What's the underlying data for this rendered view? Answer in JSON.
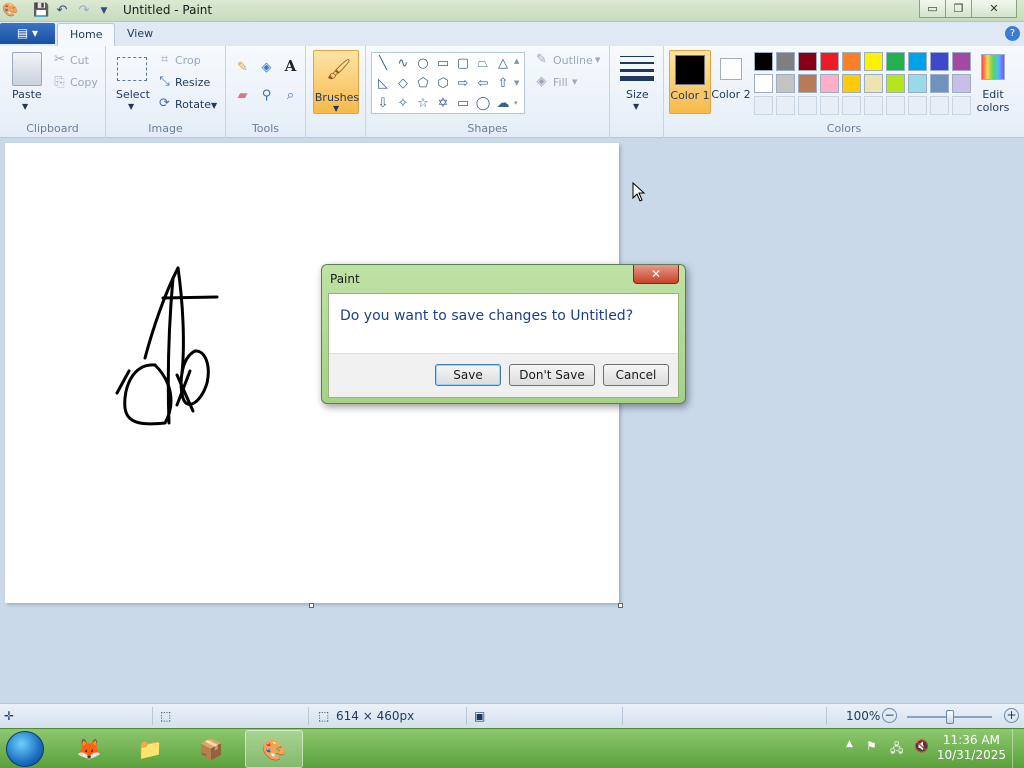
{
  "window": {
    "title": "Untitled - Paint",
    "controls": {
      "minimize": "▭",
      "maximize": "❐",
      "close": "✕"
    }
  },
  "tabs": [
    {
      "label": "Home",
      "active": true
    },
    {
      "label": "View",
      "active": false
    }
  ],
  "ribbon": {
    "clipboard": {
      "label": "Clipboard",
      "paste": "Paste",
      "cut": "Cut",
      "copy": "Copy"
    },
    "image": {
      "label": "Image",
      "select": "Select",
      "crop": "Crop",
      "resize": "Resize",
      "rotate": "Rotate"
    },
    "tools": {
      "label": "Tools"
    },
    "brushes": {
      "label": "Brushes"
    },
    "shapes": {
      "label": "Shapes",
      "outline": "Outline",
      "fill": "Fill"
    },
    "size": {
      "label": "Size"
    },
    "colors": {
      "label": "Colors",
      "color1": "Color 1",
      "color2": "Color 2",
      "edit": "Edit colors",
      "color1_value": "#000000",
      "color2_value": "#ffffff",
      "palette_row1": [
        "#000000",
        "#7f7f7f",
        "#880015",
        "#ed1c24",
        "#ff7f27",
        "#fff200",
        "#22b14c",
        "#00a2e8",
        "#3f48cc",
        "#a349a4"
      ],
      "palette_row2": [
        "#ffffff",
        "#c3c3c3",
        "#b97a57",
        "#ffaec9",
        "#ffc90e",
        "#efe4b0",
        "#b5e61d",
        "#99d9ea",
        "#7092be",
        "#c8bfe7"
      ]
    }
  },
  "dialog": {
    "title": "Paint",
    "close": "✕",
    "message": "Do you want to save changes to Untitled?",
    "save": "Save",
    "dont_save": "Don't Save",
    "cancel": "Cancel"
  },
  "status": {
    "canvas_size": "614 × 460px",
    "zoom": "100%",
    "zoom_level": 100
  },
  "taskbar": {
    "time": "11:36 AM",
    "date": "10/31/2025"
  }
}
